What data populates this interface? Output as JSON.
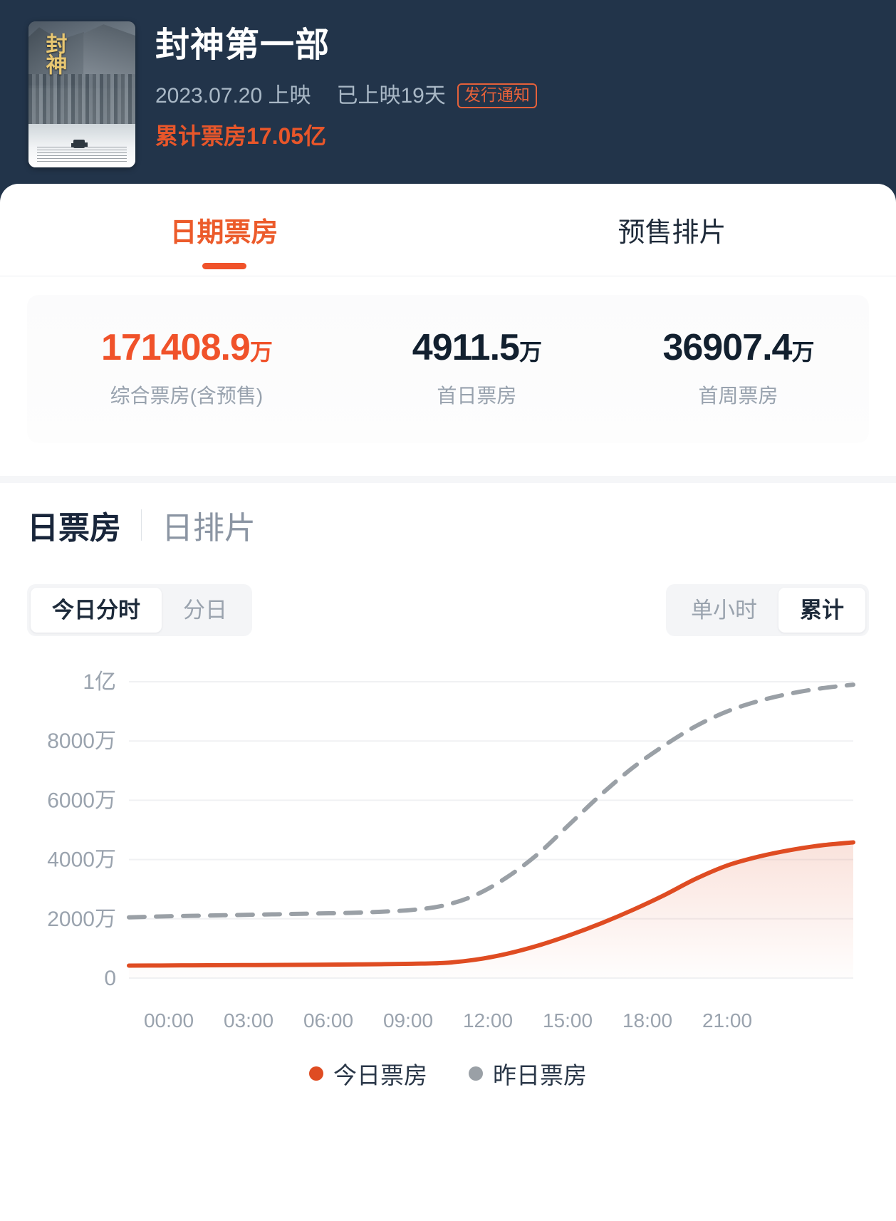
{
  "colors": {
    "header_bg": "#22344a",
    "accent": "#f0522a",
    "accent_text": "#e8562a",
    "today_line": "#df4c22",
    "yesterday_line": "#9aa0a6",
    "muted_text": "#9aa3ae"
  },
  "header": {
    "poster_title": "封神",
    "movie_title": "封神第一部",
    "release_date": "2023.07.20 上映",
    "days_released": "已上映19天",
    "notice_badge": "发行通知",
    "total_boxoffice": "累计票房17.05亿"
  },
  "tabs": [
    {
      "label": "日期票房",
      "active": true
    },
    {
      "label": "预售排片",
      "active": false
    }
  ],
  "stats": [
    {
      "value": "171408.9",
      "unit": "万",
      "label": "综合票房(含预售)",
      "primary": true
    },
    {
      "value": "4911.5",
      "unit": "万",
      "label": "首日票房",
      "primary": false
    },
    {
      "value": "36907.4",
      "unit": "万",
      "label": "首周票房",
      "primary": false
    }
  ],
  "section": {
    "title_active": "日票房",
    "title_inactive": "日排片"
  },
  "segments": {
    "left": [
      {
        "label": "今日分时",
        "on": true
      },
      {
        "label": "分日",
        "on": false
      }
    ],
    "right": [
      {
        "label": "单小时",
        "on": false
      },
      {
        "label": "累计",
        "on": true
      }
    ]
  },
  "chart_data": {
    "type": "line",
    "title": "",
    "xlabel": "",
    "ylabel": "",
    "grid": true,
    "legend_position": "bottom",
    "ylim": [
      0,
      100000000
    ],
    "yticks": [
      0,
      20000000,
      40000000,
      60000000,
      80000000,
      100000000
    ],
    "ytick_labels": [
      "0",
      "2000万",
      "4000万",
      "6000万",
      "8000万",
      "1亿"
    ],
    "x": [
      "00:00",
      "03:00",
      "06:00",
      "09:00",
      "12:00",
      "15:00",
      "18:00",
      "21:00"
    ],
    "xtick_labels": [
      "00:00",
      "03:00",
      "06:00",
      "09:00",
      "12:00",
      "15:00",
      "18:00",
      "21:00"
    ],
    "x_hours": [
      0,
      1,
      2,
      3,
      4,
      5,
      6,
      7,
      8,
      9,
      10,
      11,
      12,
      13,
      14,
      15,
      16,
      17,
      18,
      19,
      20,
      21,
      22,
      23
    ],
    "series": [
      {
        "name": "今日票房",
        "color": "#df4c22",
        "style": "solid",
        "filled": true,
        "values": [
          4200000,
          4250000,
          4300000,
          4350000,
          4400000,
          4450000,
          4500000,
          4600000,
          4700000,
          4850000,
          5100000,
          6200000,
          8200000,
          11000000,
          14500000,
          18500000,
          23000000,
          28000000,
          33500000,
          38000000,
          41000000,
          43200000,
          44800000,
          45800000
        ]
      },
      {
        "name": "昨日票房",
        "color": "#9aa0a6",
        "style": "dashed",
        "filled": false,
        "values": [
          20500000,
          20800000,
          21000000,
          21200000,
          21400000,
          21600000,
          21800000,
          22000000,
          22400000,
          23000000,
          24500000,
          28000000,
          34000000,
          42000000,
          52000000,
          62000000,
          71000000,
          78500000,
          85000000,
          90000000,
          93500000,
          96000000,
          97800000,
          99000000
        ]
      }
    ]
  },
  "legend": [
    {
      "label": "今日票房",
      "color": "#df4c22"
    },
    {
      "label": "昨日票房",
      "color": "#9aa0a6"
    }
  ]
}
